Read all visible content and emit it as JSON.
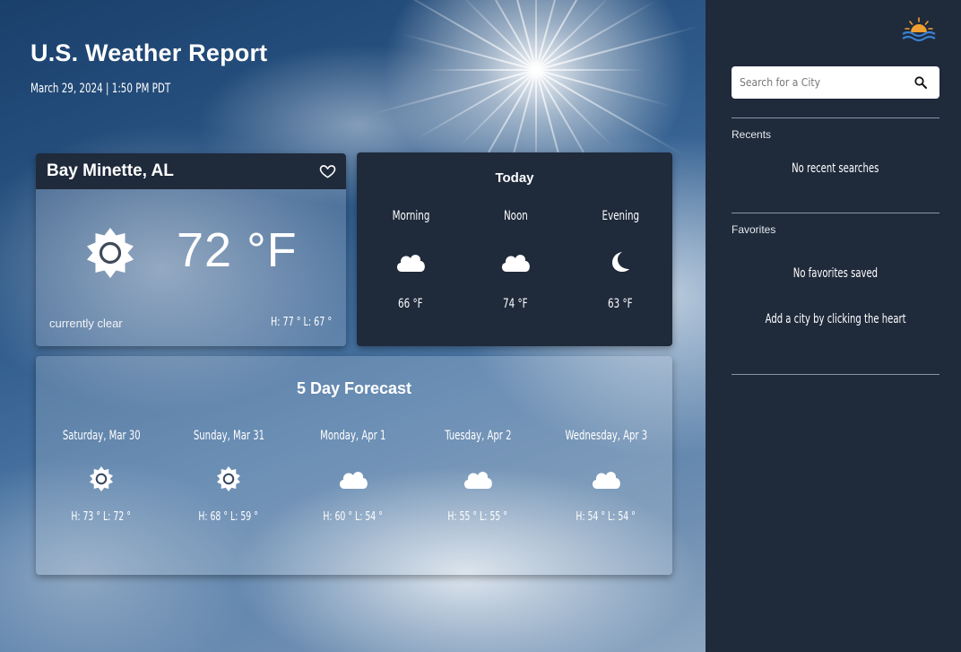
{
  "header": {
    "title": "U.S. Weather Report",
    "datetime": "March 29, 2024 | 1:50 PM PDT"
  },
  "current": {
    "city": "Bay Minette, AL",
    "temperature": "72 °F",
    "condition": "currently clear",
    "high_low": "H: 77 °  L: 67 °",
    "icon": "sun-icon"
  },
  "today": {
    "title": "Today",
    "periods": [
      {
        "label": "Morning",
        "temp": "66 °F",
        "icon": "cloud-icon"
      },
      {
        "label": "Noon",
        "temp": "74 °F",
        "icon": "cloud-icon"
      },
      {
        "label": "Evening",
        "temp": "63 °F",
        "icon": "moon-icon"
      }
    ]
  },
  "forecast": {
    "title": "5 Day Forecast",
    "days": [
      {
        "name": "Saturday, Mar 30",
        "hl": "H: 73 °   L: 72 °",
        "icon": "sun-icon"
      },
      {
        "name": "Sunday, Mar 31",
        "hl": "H: 68 °   L: 59 °",
        "icon": "sun-icon"
      },
      {
        "name": "Monday, Apr 1",
        "hl": "H: 60 °   L: 54 °",
        "icon": "cloud-icon"
      },
      {
        "name": "Tuesday, Apr 2",
        "hl": "H: 55 °   L: 55 °",
        "icon": "cloud-icon"
      },
      {
        "name": "Wednesday, Apr 3",
        "hl": "H: 54 °   L: 54 °",
        "icon": "cloud-icon"
      }
    ]
  },
  "sidebar": {
    "logo_icon": "sun-over-waves-logo",
    "search_placeholder": "Search for a City",
    "search_value": "",
    "recents_label": "Recents",
    "recents_empty": "No recent searches",
    "favorites_label": "Favorites",
    "favorites_empty": "No favorites saved",
    "favorites_hint": "Add a city by clicking the heart"
  },
  "colors": {
    "panel": "#1f2a3b",
    "text": "#ffffff",
    "logo_sun": "#f0a030",
    "logo_waves": "#3a7fd0"
  }
}
